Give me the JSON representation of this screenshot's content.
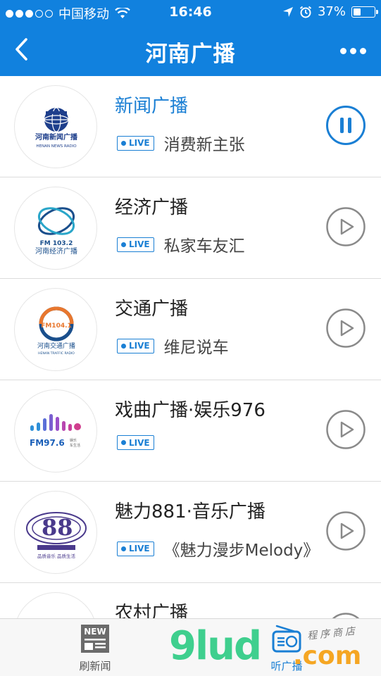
{
  "status_bar": {
    "carrier": "中国移动",
    "time": "16:46",
    "battery_percent": "37%",
    "battery_level": 0.37,
    "signal_bars_filled": 3,
    "signal_bars_total": 5
  },
  "nav": {
    "title": "河南广播",
    "back_icon": "chevron-left-icon",
    "more_icon": "more-dots-icon"
  },
  "colors": {
    "primary": "#1181de",
    "accent": "#1a7fd4",
    "play_gray": "#8a8a8a"
  },
  "live_label": "LIVE",
  "stations": [
    {
      "name": "新闻广播",
      "program": "消费新主张",
      "live": true,
      "state": "playing",
      "logo": "henan-news-radio-logo",
      "logo_text": [
        "河南新闻广播",
        "HENAN NEWS RADIO"
      ]
    },
    {
      "name": "经济广播",
      "program": "私家车友汇",
      "live": true,
      "state": "stopped",
      "logo": "henan-economic-radio-logo",
      "logo_text": [
        "FM 103.2",
        "河南经济广播"
      ]
    },
    {
      "name": "交通广播",
      "program": "维尼说车",
      "live": true,
      "state": "stopped",
      "logo": "henan-traffic-radio-logo",
      "logo_text": [
        "FM104.1",
        "河南交通广播",
        "HENAN TRAFFIC RADIO"
      ]
    },
    {
      "name": "戏曲广播·娱乐976",
      "program": "",
      "live": true,
      "state": "stopped",
      "logo": "fm976-logo",
      "logo_text": [
        "FM97.6",
        "娱乐",
        "车生活"
      ]
    },
    {
      "name": "魅力881·音乐广播",
      "program": "《魅力漫步Melody》",
      "live": true,
      "state": "stopped",
      "logo": "charm-881-logo",
      "logo_text": [
        "品质音乐 品质生活"
      ]
    },
    {
      "name": "农村广播",
      "program": "",
      "live": false,
      "state": "stopped",
      "logo": "rural-radio-logo",
      "logo_text": []
    }
  ],
  "tabs": [
    {
      "label": "刷新闻",
      "icon": "news-icon",
      "badge": "NEW",
      "active": false
    },
    {
      "label": "听广播",
      "icon": "radio-icon",
      "active": true
    }
  ],
  "watermark": {
    "main": "9lud",
    "suffix": ".com",
    "small": "程序商店"
  }
}
